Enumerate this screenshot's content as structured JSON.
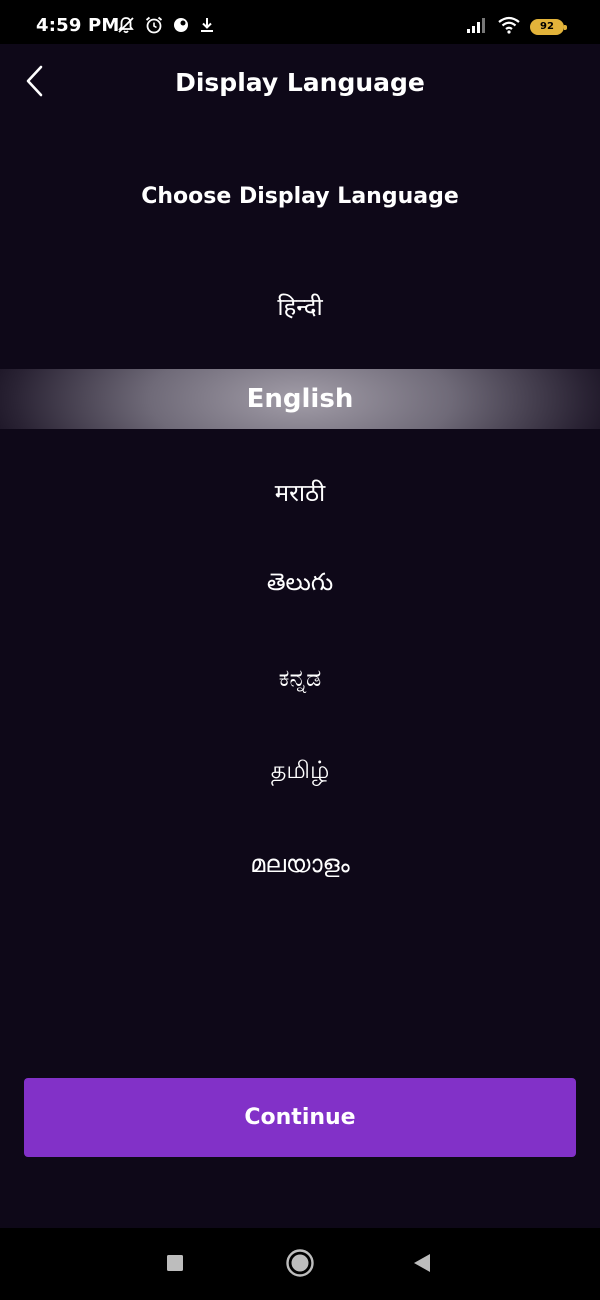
{
  "status_bar": {
    "time": "4:59 PM",
    "battery_level": "92",
    "left_icons": [
      "bell-off-icon",
      "alarm-clock-icon",
      "app-notification-icon",
      "download-icon"
    ],
    "right_icons": [
      "cellular-signal-icon",
      "wifi-icon",
      "battery-icon"
    ],
    "battery_color": "#e2b33a"
  },
  "header": {
    "title": "Display Language",
    "back_icon": "chevron-left-icon"
  },
  "main": {
    "subtitle": "Choose Display Language",
    "languages": [
      {
        "label": "हिन्दी",
        "selected": false
      },
      {
        "label": "English",
        "selected": true
      },
      {
        "label": "मराठी",
        "selected": false
      },
      {
        "label": "తెలుగు",
        "selected": false
      },
      {
        "label": "ಕನ್ನಡ",
        "selected": false
      },
      {
        "label": "தமிழ்",
        "selected": false
      },
      {
        "label": "മലയാളം",
        "selected": false
      }
    ]
  },
  "footer": {
    "continue_label": "Continue",
    "accent_color": "#8231c8"
  },
  "nav_bar": {
    "icons": [
      "recents-square-icon",
      "home-circle-icon",
      "back-triangle-icon"
    ]
  },
  "colors": {
    "background": "#0e0818",
    "text": "#ffffff"
  }
}
